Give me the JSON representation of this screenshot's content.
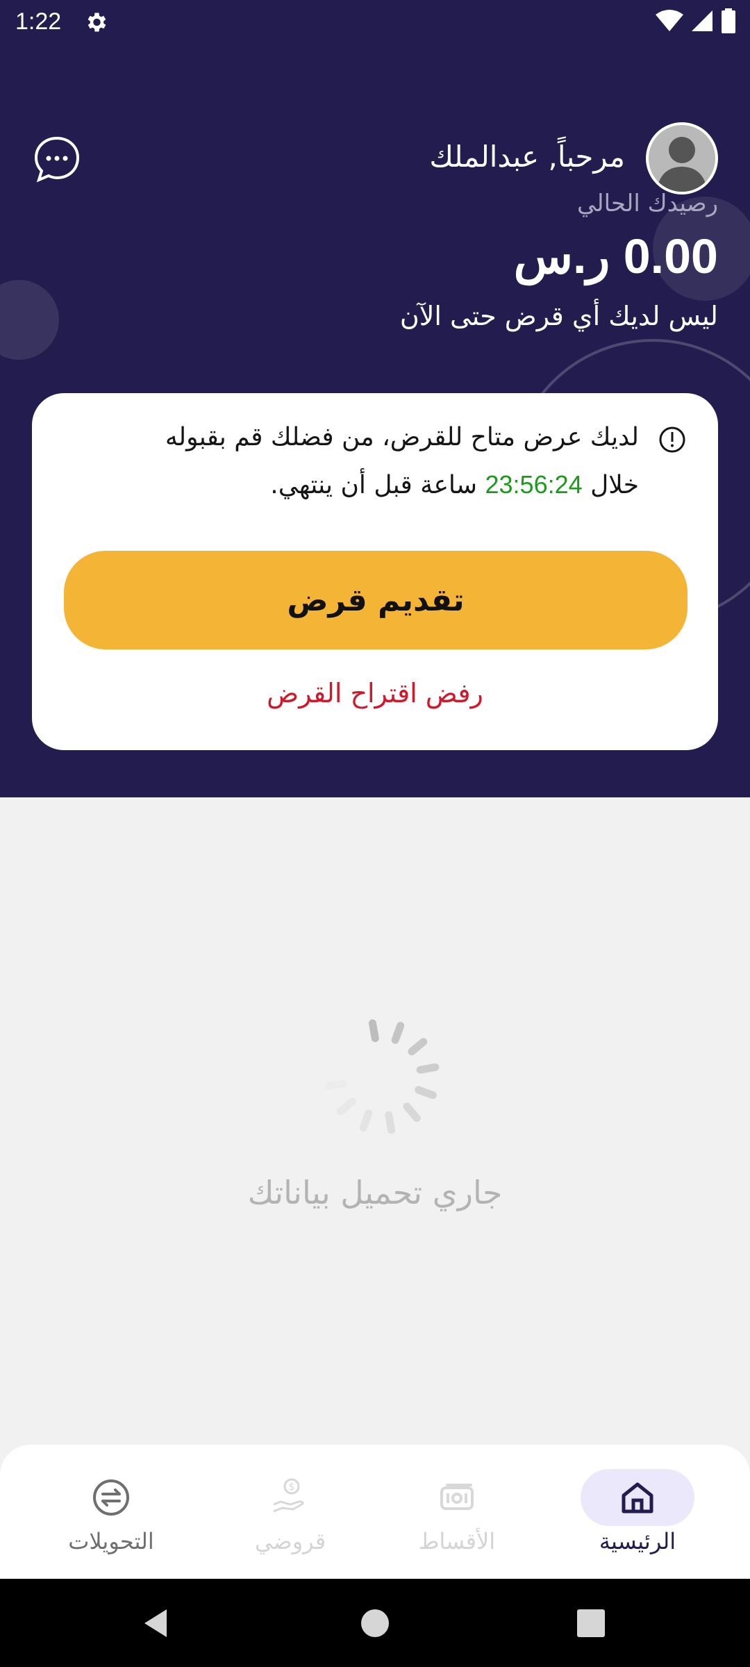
{
  "status_bar": {
    "time": "1:22",
    "icons": [
      "settings-icon",
      "wifi-icon",
      "signal-icon",
      "battery-icon"
    ]
  },
  "header": {
    "greeting": "مرحباً, عبدالملك",
    "balance_label": "رصيدك الحالي",
    "balance_amount": "0.00 ر.س",
    "no_loan_text": "ليس لديك أي قرض حتى الآن"
  },
  "offer_card": {
    "text_line1": "لديك عرض متاح للقرض، من فضلك قم بقبوله",
    "text_line2_prefix": "خلال",
    "countdown": "23:56:24",
    "text_line2_suffix": "ساعة قبل أن ينتهي.",
    "submit_label": "تقديم قرض",
    "reject_label": "رفض اقتراح القرض"
  },
  "loading": {
    "text": "جاري تحميل بياناتك"
  },
  "bottom_nav": {
    "items": [
      {
        "label": "الرئيسية",
        "icon": "home-icon",
        "active": true
      },
      {
        "label": "الأقساط",
        "icon": "installments-icon",
        "active": false
      },
      {
        "label": "قروضي",
        "icon": "loans-icon",
        "active": false
      },
      {
        "label": "التحويلات",
        "icon": "transfers-icon",
        "active": true
      }
    ]
  },
  "colors": {
    "brand_dark": "#231c4e",
    "accent": "#f4b436",
    "danger": "#d0182b",
    "countdown": "#1a9c1a",
    "nav_active_bg": "#ebe8fb"
  }
}
